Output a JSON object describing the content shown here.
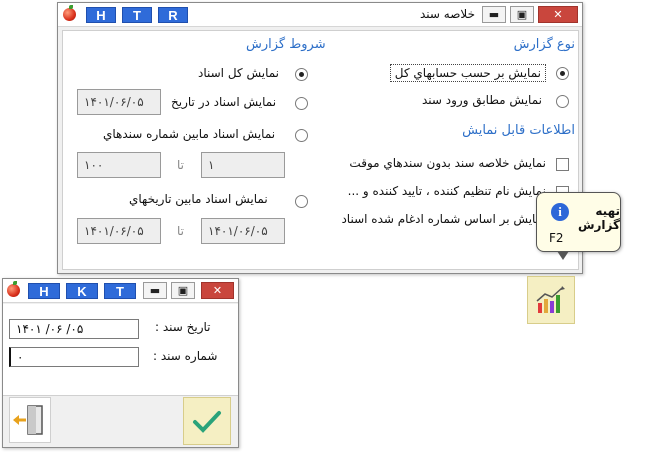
{
  "main_window": {
    "title": "خلاصه سند",
    "letter_buttons": [
      "H",
      "T",
      "R"
    ],
    "report_type": {
      "title": "نوع گزارش",
      "options": [
        {
          "label": "نمايش بر حسب حسابهاي کل",
          "selected": true
        },
        {
          "label": "نمايش مطابق ورود سند",
          "selected": false
        }
      ]
    },
    "display_info": {
      "title": "اطلاعات قابل نمايش",
      "options": [
        {
          "label": "نمايش خلاصه سند بدون سندهاي موقت",
          "checked": false
        },
        {
          "label": "نمايش نام تنظيم کننده ، تاييد کننده و ...",
          "checked": false
        },
        {
          "label": "نمايش بر اساس شماره ادغام شده اسناد",
          "checked": false
        }
      ]
    },
    "conditions": {
      "title": "شروط گزارش",
      "opt_all": "نمايش کل اسناد",
      "opt_date": "نمايش اسناد در تاريخ",
      "date_value": "۱۴۰۱/۰۶/۰۵",
      "opt_range_number": "نمايش اسناد مابين شماره سندهاي",
      "number_from": "۱",
      "number_to": "۱۰۰",
      "to_label": "تا",
      "opt_range_date": "نمايش اسناد مابين تاريخهاي",
      "date_from": "۱۴۰۱/۰۶/۰۵",
      "date_to": "۱۴۰۱/۰۶/۰۵"
    },
    "tooltip": {
      "title": "تهيه گزارش",
      "shortcut": "F2"
    }
  },
  "dialog": {
    "letter_buttons": [
      "H",
      "K",
      "T"
    ],
    "date_label": "تاريخ سند :",
    "date_value": "۱۴۰۱   /۰۶ /۰۵",
    "number_label": "شماره سند :",
    "number_value": "۰"
  },
  "colors": {
    "section_title": "#2d6fc8",
    "letter_button": "#2f6bd9",
    "close_button": "#c9463d",
    "highlight_button": "#f5efc3"
  },
  "icons": {
    "report": "chart-icon",
    "confirm": "checkmark-icon",
    "exit": "exit-door-icon",
    "info": "info-icon"
  }
}
